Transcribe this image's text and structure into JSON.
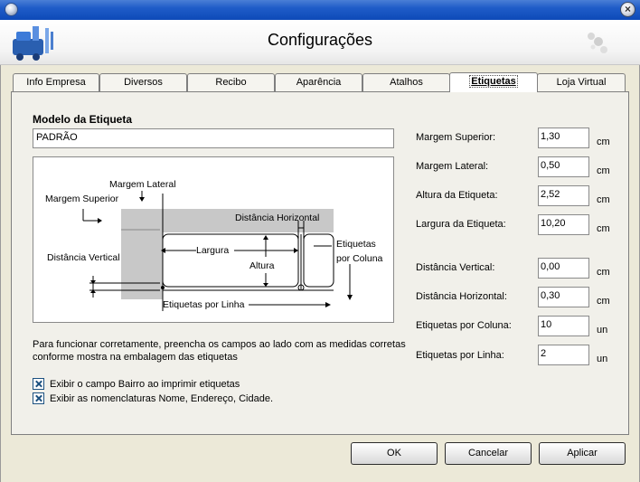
{
  "window": {
    "title": "Configurações"
  },
  "tabs": [
    {
      "label": "Info Empresa"
    },
    {
      "label": "Diversos"
    },
    {
      "label": "Recibo"
    },
    {
      "label": "Aparência"
    },
    {
      "label": "Atalhos"
    },
    {
      "label": "Etiquetas",
      "active": true
    },
    {
      "label": "Loja Virtual"
    }
  ],
  "model": {
    "title": "Modelo da Etiqueta",
    "value": "PADRÃO"
  },
  "diagram": {
    "margem_lateral": "Margem Lateral",
    "margem_superior": "Margem Superior",
    "distancia_horizontal": "Distância Horizontal",
    "distancia_vertical": "Distância Vertical",
    "largura": "Largura",
    "altura": "Altura",
    "etiquetas_por_coluna_1": "Etiquetas",
    "etiquetas_por_coluna_2": "por Coluna",
    "etiquetas_por_linha": "Etiquetas por Linha"
  },
  "info_text": "Para funcionar corretamente, preencha os campos ao lado com as medidas corretas conforme mostra na embalagem das etiquetas",
  "checkboxes": [
    {
      "label": "Exibir o campo Bairro ao imprimir etiquetas",
      "checked": true
    },
    {
      "label": "Exibir as nomenclaturas Nome, Endereço, Cidade.",
      "checked": true
    }
  ],
  "fields": [
    {
      "label": "Margem Superior:",
      "value": "1,30",
      "unit": "cm"
    },
    {
      "label": "Margem Lateral:",
      "value": "0,50",
      "unit": "cm"
    },
    {
      "label": "Altura da Etiqueta:",
      "value": "2,52",
      "unit": "cm"
    },
    {
      "label": "Largura da Etiqueta:",
      "value": "10,20",
      "unit": "cm"
    },
    {
      "label": "Distância Vertical:",
      "value": "0,00",
      "unit": "cm"
    },
    {
      "label": "Distância Horizontal:",
      "value": "0,30",
      "unit": "cm"
    },
    {
      "label": "Etiquetas por Coluna:",
      "value": "10",
      "unit": "un"
    },
    {
      "label": "Etiquetas por Linha:",
      "value": "2",
      "unit": "un"
    }
  ],
  "buttons": {
    "ok": "OK",
    "cancel": "Cancelar",
    "apply": "Aplicar"
  }
}
